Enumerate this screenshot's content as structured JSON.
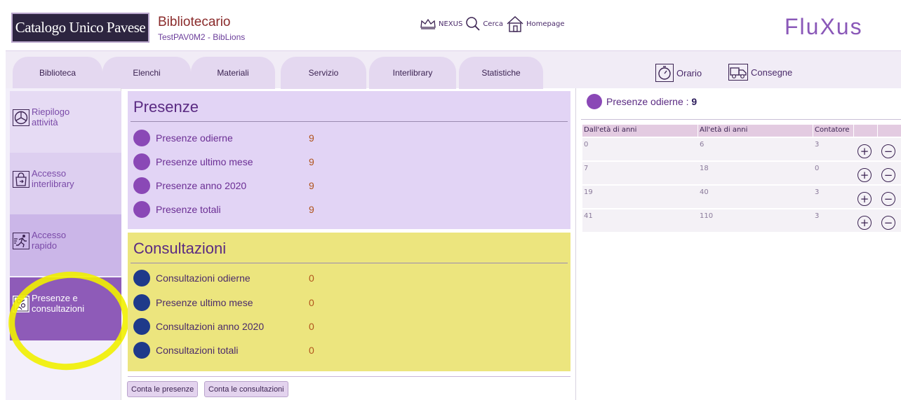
{
  "header": {
    "logo_text": "Catalogo Unico Pavese",
    "role": "Bibliotecario",
    "user": "TestPAV0M2 - BibLions",
    "links": [
      {
        "label": "NEXUS",
        "icon": "crown-icon"
      },
      {
        "label": "Cerca",
        "icon": "search-icon"
      },
      {
        "label": "Homepage",
        "icon": "home-icon"
      }
    ],
    "brand": "FluXus"
  },
  "tabs": [
    "Biblioteca",
    "Elenchi",
    "Materiali",
    "Servizio",
    "Interlibrary",
    "Statistiche"
  ],
  "actions": [
    {
      "label": "Orario",
      "icon": "stopwatch-icon"
    },
    {
      "label": "Consegne",
      "icon": "delivery-truck-icon"
    }
  ],
  "sidebar": {
    "items": [
      {
        "line1": "Riepilogo",
        "line2": "attività",
        "icon": "pie-chart-icon"
      },
      {
        "line1": "Accesso",
        "line2": "interlibrary",
        "icon": "bag-icon"
      },
      {
        "line1": "Accesso",
        "line2": "rapido",
        "icon": "runner-icon"
      },
      {
        "line1": "Presenze e",
        "line2": "consultazioni",
        "icon": "people-icon"
      }
    ]
  },
  "presenze": {
    "title": "Presenze",
    "rows": [
      {
        "label": "Presenze odierne",
        "value": "9"
      },
      {
        "label": "Presenze ultimo mese",
        "value": "9"
      },
      {
        "label": "Presenze anno 2020",
        "value": "9"
      },
      {
        "label": "Presenze totali",
        "value": "9"
      }
    ]
  },
  "consultazioni": {
    "title": "Consultazioni",
    "rows": [
      {
        "label": "Consultazioni odierne",
        "value": "0"
      },
      {
        "label": "Presenze ultimo mese",
        "value": "0"
      },
      {
        "label": "Consultazioni anno 2020",
        "value": "0"
      },
      {
        "label": "Consultazioni totali",
        "value": "0"
      }
    ]
  },
  "buttons": {
    "conta_presenze": "Conta le presenze",
    "conta_consultazioni": "Conta le consultazioni"
  },
  "right_panel": {
    "title": "Presenze odierne : ",
    "count": "9",
    "columns": [
      "Dall'età di anni",
      "All'età di anni",
      "Contatore"
    ],
    "rows": [
      {
        "from": "0",
        "to": "6",
        "counter": "3"
      },
      {
        "from": "7",
        "to": "18",
        "counter": "0"
      },
      {
        "from": "19",
        "to": "40",
        "counter": "3"
      },
      {
        "from": "41",
        "to": "110",
        "counter": "3"
      }
    ],
    "plus_symbol": "+",
    "minus_symbol": "−"
  },
  "colors": {
    "accent": "#8a58b8",
    "presenze_panel": "#e2d4f5",
    "consultazioni_panel": "#ece57e",
    "sidebar_active": "#8e5bb8",
    "highlight": "#f1f000"
  }
}
